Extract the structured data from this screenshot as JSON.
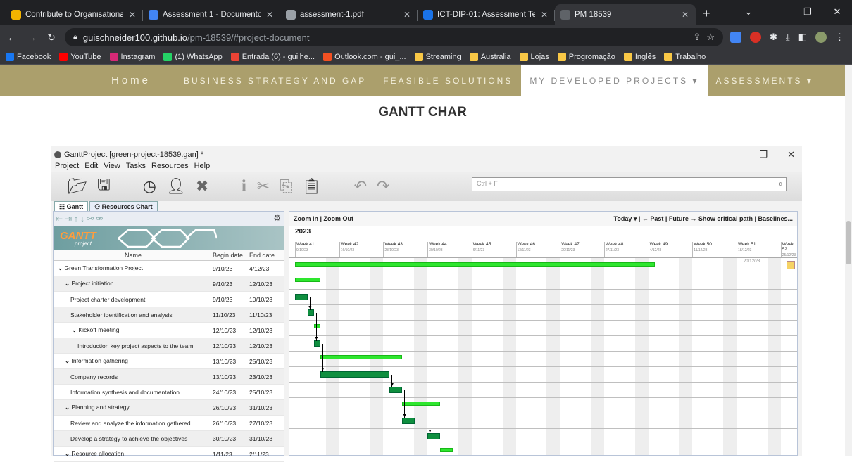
{
  "browser": {
    "tabs": [
      {
        "title": "Contribute to Organisational Pr",
        "color": "#f4b400"
      },
      {
        "title": "Assessment 1 - Documentos Go",
        "color": "#4285f4"
      },
      {
        "title": "assessment-1.pdf",
        "color": "#9aa0a6"
      },
      {
        "title": "ICT-DIP-01: Assessment Templat",
        "color": "#1a73e8"
      },
      {
        "title": "PM 18539",
        "color": "#5f6368"
      }
    ],
    "url_host": "guischneider100.github.io",
    "url_path": "/pm-18539/#project-document",
    "bookmarks": [
      {
        "label": "Facebook",
        "color": "#1877f2"
      },
      {
        "label": "YouTube",
        "color": "#ff0000"
      },
      {
        "label": "Instagram",
        "color": "#d62976"
      },
      {
        "label": "(1) WhatsApp",
        "color": "#25d366"
      },
      {
        "label": "Entrada (6) - guilhe...",
        "color": "#ea4335"
      },
      {
        "label": "Outlook.com - gui_...",
        "color": "#f25022"
      },
      {
        "label": "Streaming",
        "color": "#f9c846"
      },
      {
        "label": "Australia",
        "color": "#f9c846"
      },
      {
        "label": "Lojas",
        "color": "#f9c846"
      },
      {
        "label": "Progromação",
        "color": "#f9c846"
      },
      {
        "label": "Inglês",
        "color": "#f9c846"
      },
      {
        "label": "Trabalho",
        "color": "#f9c846"
      }
    ]
  },
  "site": {
    "nav": {
      "home": "Home",
      "business": "BUSINESS STRATEGY AND GAP",
      "feasible": "FEASIBLE SOLUTIONS",
      "projects": "MY DEVELOPED PROJECTS ▾",
      "assessments": "ASSESSMENTS ▾"
    },
    "heading": "GANTT CHAR",
    "accent": "#ab9f6c"
  },
  "gantt_app": {
    "title": "GanttProject [green-project-18539.gan] *",
    "menu": [
      "Project",
      "Edit",
      "View",
      "Tasks",
      "Resources",
      "Help"
    ],
    "search_placeholder": "Ctrl + F",
    "tabs": [
      "Gantt",
      "Resources Chart"
    ],
    "logo_text": "GANTT",
    "logo_sub": "project",
    "columns": {
      "name": "Name",
      "begin": "Begin date",
      "end": "End date"
    },
    "chart_toolbar": {
      "zoom": "Zoom In  |  Zoom Out",
      "right": "Today ▾  |  ← Past  |  Future →     Show critical path  |  Baselines..."
    },
    "year": "2023",
    "weeks": [
      {
        "label": "Week 41",
        "date": "9/10/23"
      },
      {
        "label": "Week 42",
        "date": "16/10/23"
      },
      {
        "label": "Week 43",
        "date": "23/10/23"
      },
      {
        "label": "Week 44",
        "date": "30/10/23"
      },
      {
        "label": "Week 45",
        "date": "6/11/23"
      },
      {
        "label": "Week 46",
        "date": "13/11/23"
      },
      {
        "label": "Week 47",
        "date": "20/11/23"
      },
      {
        "label": "Week 48",
        "date": "27/11/23"
      },
      {
        "label": "Week 49",
        "date": "4/12/23"
      },
      {
        "label": "Week 50",
        "date": "11/12/23"
      },
      {
        "label": "Week 51",
        "date": "18/12/23"
      },
      {
        "label": "Week 52",
        "date": "25/12/23"
      }
    ],
    "deadline_marker": "20/12/23",
    "tasks": [
      {
        "name": "Green Transformation Project",
        "begin": "9/10/23",
        "end": "4/12/23",
        "level": 0,
        "group": true
      },
      {
        "name": "Project initiation",
        "begin": "9/10/23",
        "end": "12/10/23",
        "level": 1,
        "group": true
      },
      {
        "name": "Project charter development",
        "begin": "9/10/23",
        "end": "10/10/23",
        "level": 2,
        "group": false
      },
      {
        "name": "Stakeholder identification and analysis",
        "begin": "11/10/23",
        "end": "11/10/23",
        "level": 2,
        "group": false
      },
      {
        "name": "Kickoff meeting",
        "begin": "12/10/23",
        "end": "12/10/23",
        "level": 2,
        "group": true
      },
      {
        "name": "Introduction key project aspects to the team",
        "begin": "12/10/23",
        "end": "12/10/23",
        "level": 3,
        "group": false
      },
      {
        "name": "Information gathering",
        "begin": "13/10/23",
        "end": "25/10/23",
        "level": 1,
        "group": true
      },
      {
        "name": "Company records",
        "begin": "13/10/23",
        "end": "23/10/23",
        "level": 2,
        "group": false
      },
      {
        "name": "Information synthesis and documentation",
        "begin": "24/10/23",
        "end": "25/10/23",
        "level": 2,
        "group": false
      },
      {
        "name": "Planning and strategy",
        "begin": "26/10/23",
        "end": "31/10/23",
        "level": 1,
        "group": true
      },
      {
        "name": "Review and analyze the information gathered",
        "begin": "26/10/23",
        "end": "27/10/23",
        "level": 2,
        "group": false
      },
      {
        "name": "Develop a strategy to achieve the objectives",
        "begin": "30/10/23",
        "end": "31/10/23",
        "level": 2,
        "group": false
      },
      {
        "name": "Resource allocation",
        "begin": "1/11/23",
        "end": "2/11/23",
        "level": 1,
        "group": true
      }
    ]
  }
}
